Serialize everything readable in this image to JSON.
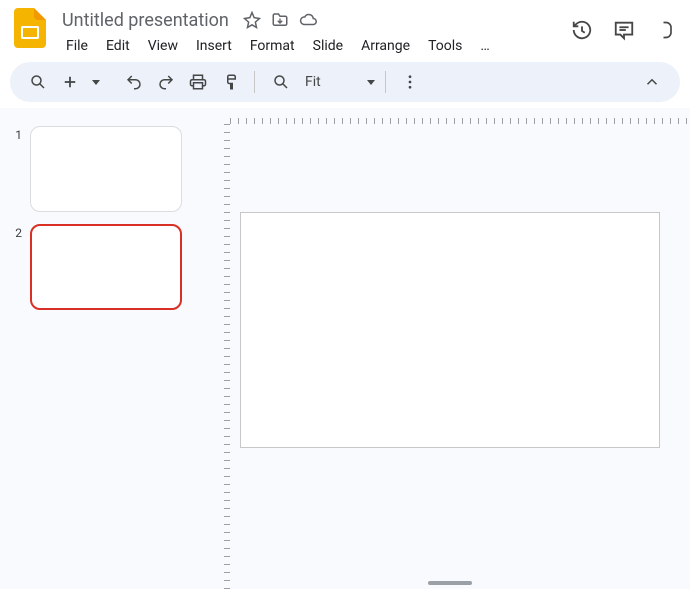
{
  "doc": {
    "title": "Untitled presentation"
  },
  "menu": {
    "file": "File",
    "edit": "Edit",
    "view": "View",
    "insert": "Insert",
    "format": "Format",
    "slide": "Slide",
    "arrange": "Arrange",
    "tools": "Tools",
    "more": "…"
  },
  "toolbar": {
    "zoom_label": "Fit"
  },
  "slides": {
    "items": [
      {
        "num": "1"
      },
      {
        "num": "2"
      }
    ]
  }
}
